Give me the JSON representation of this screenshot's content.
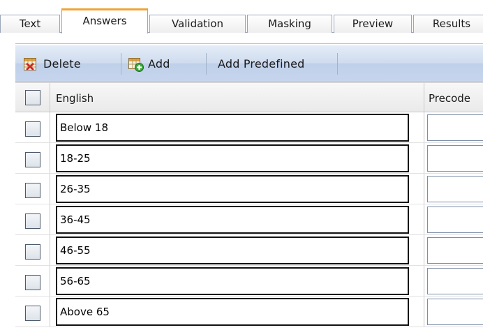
{
  "tabs": [
    {
      "label": "Text",
      "active": false
    },
    {
      "label": "Answers",
      "active": true
    },
    {
      "label": "Validation",
      "active": false
    },
    {
      "label": "Masking",
      "active": false
    },
    {
      "label": "Preview",
      "active": false
    },
    {
      "label": "Results",
      "active": false
    }
  ],
  "toolbar": {
    "delete_label": "Delete",
    "add_label": "Add",
    "add_predefined_label": "Add Predefined",
    "delete_icon": "delete-grid-icon",
    "add_icon": "add-grid-icon"
  },
  "grid": {
    "columns": {
      "english": "English",
      "precode": "Precode"
    },
    "rows": [
      {
        "english": "Below 18",
        "precode": ""
      },
      {
        "english": "18-25",
        "precode": ""
      },
      {
        "english": "26-35",
        "precode": ""
      },
      {
        "english": "36-45",
        "precode": ""
      },
      {
        "english": "46-55",
        "precode": ""
      },
      {
        "english": "56-65",
        "precode": ""
      },
      {
        "english": "Above 65",
        "precode": ""
      }
    ]
  },
  "colors": {
    "active_tab_accent": "#f0a338",
    "toolbar_bg": "#cfdcef"
  }
}
